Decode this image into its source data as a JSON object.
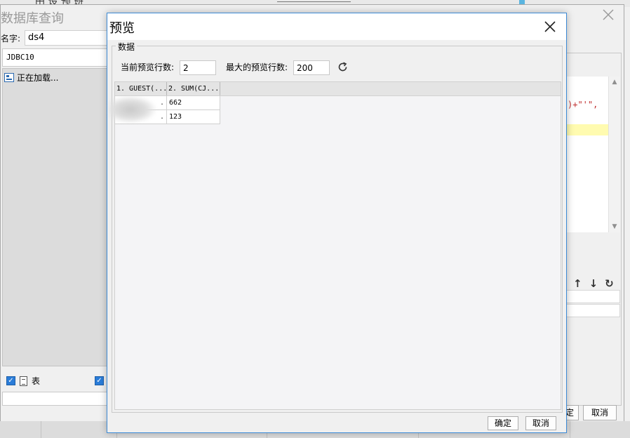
{
  "background": {
    "title": "数据库查询",
    "top_stub_text": "田 设 预 班",
    "name_label": "名字:",
    "name_value": "ds4",
    "connection": "JDBC10",
    "tree_loading": "正在加载...",
    "table_checkbox_label": "表",
    "code_snippet": ")+\"'\",",
    "ok_partial": "定",
    "cancel_label": "取消"
  },
  "dialog": {
    "title": "预览",
    "group_title": "数据",
    "current_rows_label": "当前预览行数:",
    "current_rows_value": "2",
    "max_rows_label": "最大的预览行数:",
    "max_rows_value": "200",
    "ok_label": "确定",
    "cancel_label": "取消",
    "table": {
      "columns": [
        "1. GUEST(...",
        "2. SUM(CJ..."
      ],
      "rows": [
        [
          ".",
          "662"
        ],
        [
          ".",
          "123"
        ]
      ]
    }
  },
  "colors": {
    "dialog_border": "#3c8ad6",
    "checkbox": "#2a7cd8",
    "highlight": "#fffbb0",
    "code_red": "#c03030"
  }
}
